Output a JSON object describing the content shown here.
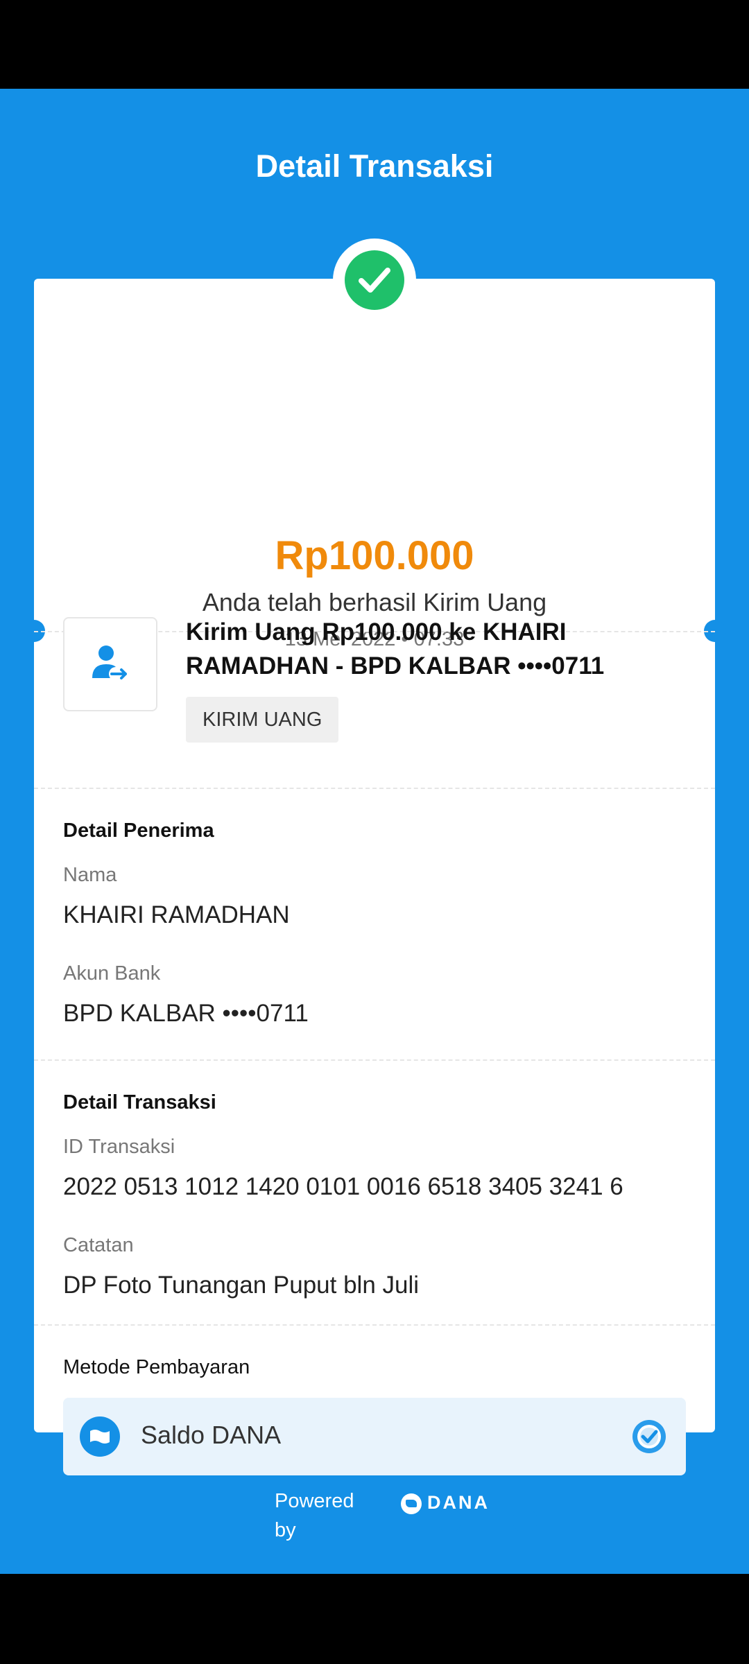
{
  "header": {
    "title": "Detail Transaksi"
  },
  "summary": {
    "amount": "Rp100.000",
    "status_text": "Anda telah berhasil Kirim Uang",
    "datetime": "13 Mei 2022 • 07:33"
  },
  "transaction": {
    "title": "Kirim Uang Rp100.000 ke KHAIRI RAMADHAN - BPD KALBAR ••••0711",
    "tag": "KIRIM UANG",
    "icon": "send-money-icon"
  },
  "recipient": {
    "section_title": "Detail Penerima",
    "name_label": "Nama",
    "name_value": "KHAIRI RAMADHAN",
    "bank_label": "Akun Bank",
    "bank_value": "BPD KALBAR ••••0711"
  },
  "details": {
    "section_title": "Detail Transaksi",
    "id_label": "ID Transaksi",
    "id_value": "2022 0513 1012 1420 0101 0016 6518 3405 3241 6",
    "note_label": "Catatan",
    "note_value": "DP Foto Tunangan Puput bln Juli"
  },
  "payment": {
    "section_title": "Metode Pembayaran",
    "method": "Saldo DANA"
  },
  "footer": {
    "powered_line1": "Powered",
    "powered_line2": "by",
    "brand": "DANA"
  },
  "colors": {
    "background": "#1490E6",
    "amount": "#F08A0B",
    "success": "#1FC06A"
  }
}
